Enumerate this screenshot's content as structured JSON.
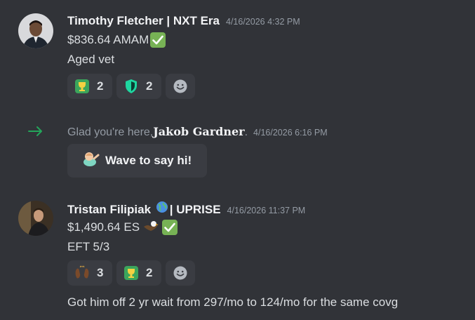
{
  "messages": [
    {
      "username": "Timothy Fletcher | NXT Era",
      "timestamp": "4/16/2026 4:32 PM",
      "line1": "$836.64 AMAM",
      "line2": "Aged vet",
      "reactions": [
        {
          "emoji": "trophy-icon",
          "count": "2"
        },
        {
          "emoji": "shield-icon",
          "count": "2"
        }
      ]
    },
    {
      "system_prefix": "Glad you're here, ",
      "system_name": "Jakob Gardner",
      "system_suffix": ".",
      "timestamp": "4/16/2026 6:16 PM",
      "wave_label": "Wave to say hi!"
    },
    {
      "username_part1": "Tristan Filipiak ",
      "username_part2": "| UPRISE",
      "timestamp": "4/16/2026 11:37 PM",
      "line1": "$1,490.64 ES",
      "line2": "EFT 5/3",
      "reactions": [
        {
          "emoji": "raised-hands-icon",
          "count": "3"
        },
        {
          "emoji": "trophy-icon",
          "count": "2"
        }
      ],
      "line3": "Got him off 2 yr wait from 297/mo to 124/mo for the same covg"
    }
  ],
  "colors": {
    "background": "#313338",
    "reaction_bg": "#3a3c42",
    "accent_green": "#23a55a",
    "check_green": "#77b255"
  }
}
